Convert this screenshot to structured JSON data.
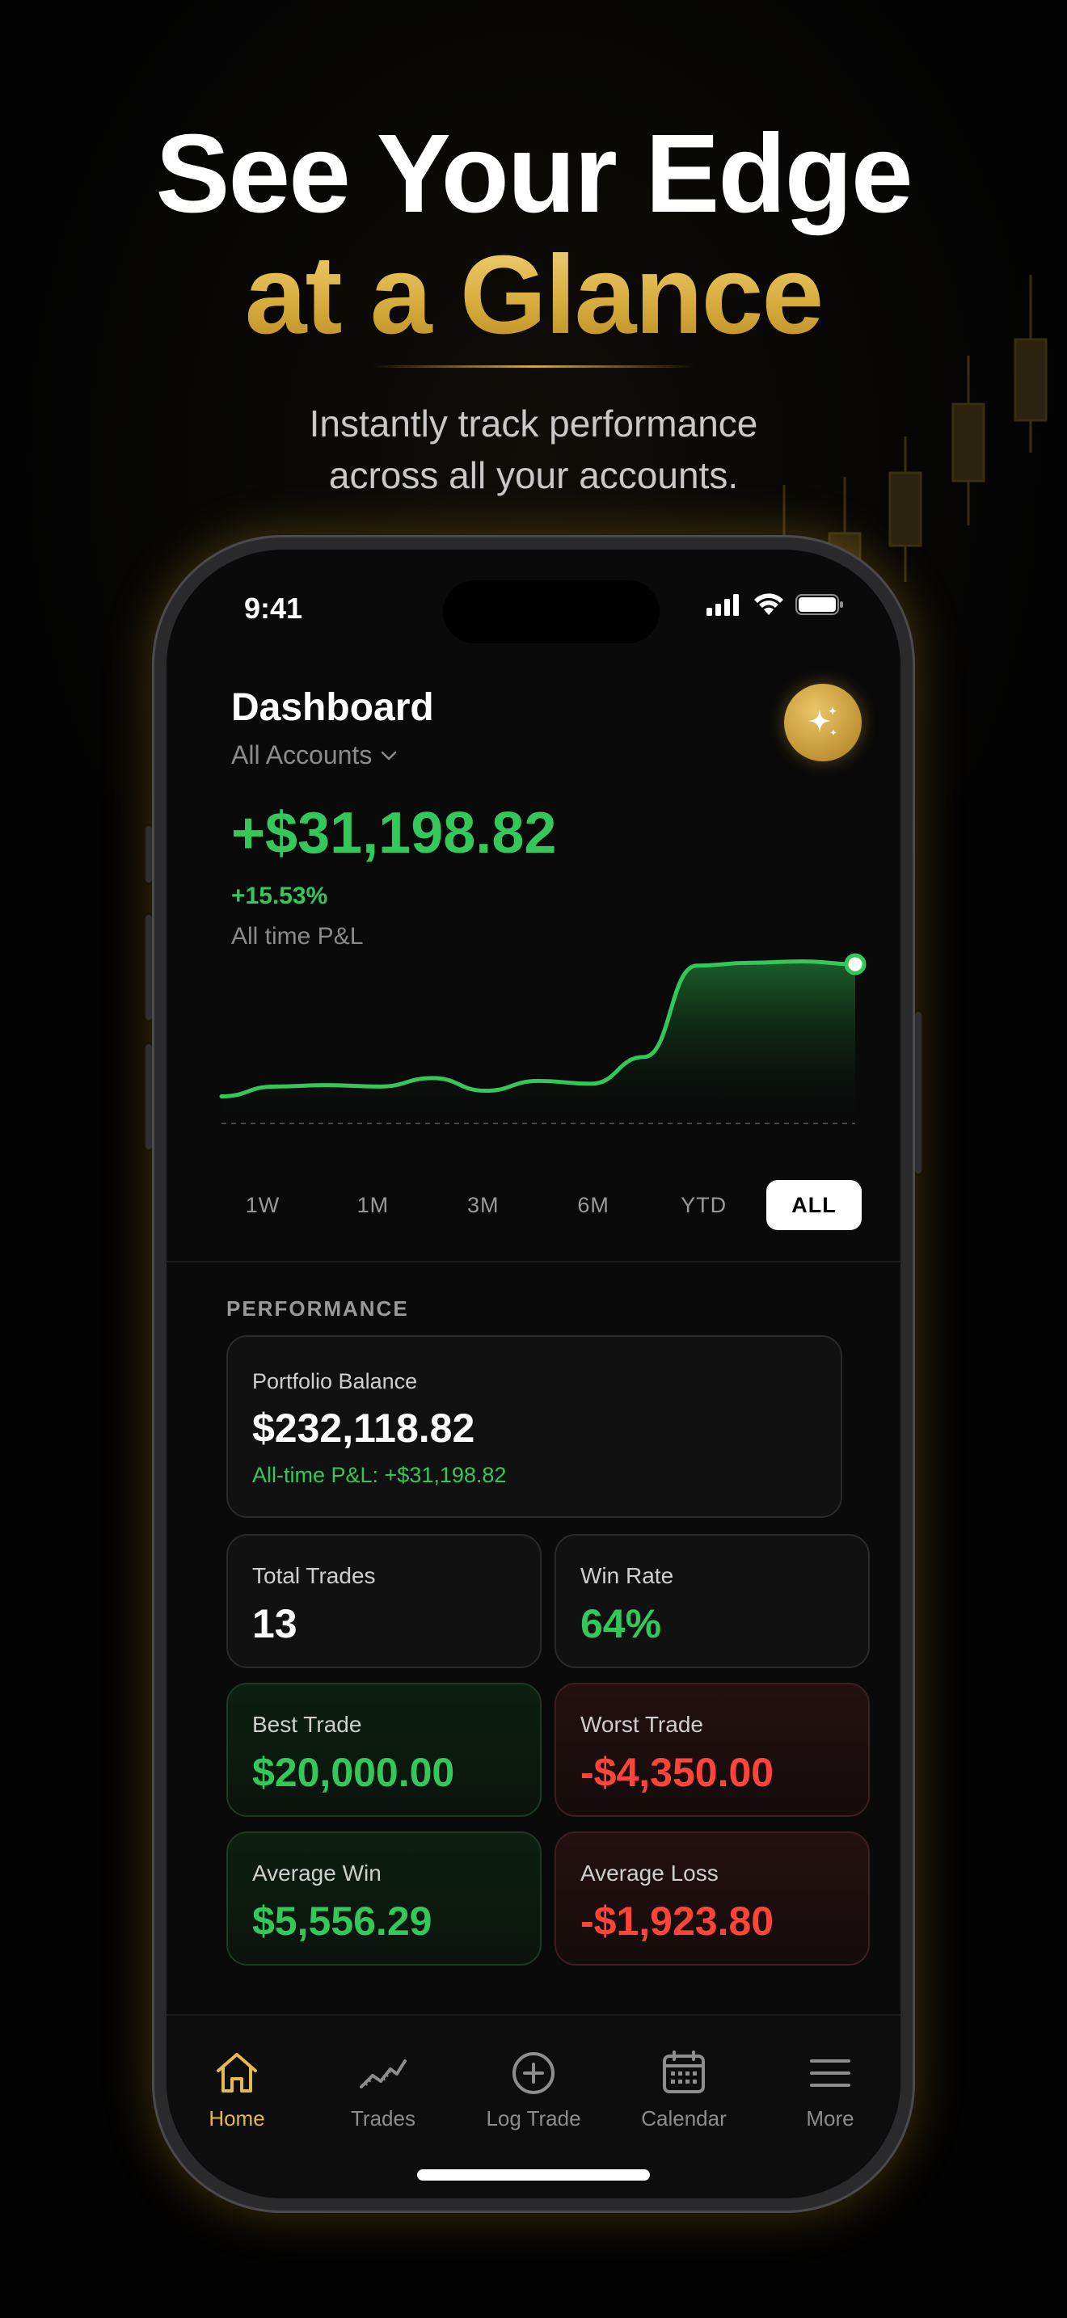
{
  "hero": {
    "title_line1": "See Your Edge",
    "title_line2": "at a Glance",
    "subtitle_line1": "Instantly track performance",
    "subtitle_line2": "across all your accounts."
  },
  "status_bar": {
    "time": "9:41"
  },
  "dashboard": {
    "title": "Dashboard",
    "account_selector": "All Accounts",
    "ai_button_icon": "sparkles-icon",
    "pnl_value": "+$31,198.82",
    "pnl_percent": "+15.53%",
    "pnl_label": "All time P&L"
  },
  "chart_data": {
    "type": "area",
    "title": "",
    "series": [
      {
        "values": [
          2,
          9,
          10,
          9,
          15,
          6,
          13,
          11,
          30,
          95,
          97,
          98,
          96
        ]
      }
    ],
    "baseline": "dashed",
    "color": "#34c759",
    "endpoint_marker": true
  },
  "ranges": {
    "items": [
      "1W",
      "1M",
      "3M",
      "6M",
      "YTD",
      "ALL"
    ],
    "selected": "ALL"
  },
  "performance": {
    "section_label": "PERFORMANCE",
    "portfolio_label": "Portfolio Balance",
    "portfolio_value": "$232,118.82",
    "portfolio_pnl": "All-time P&L: +$31,198.82",
    "total_trades_label": "Total Trades",
    "total_trades_value": "13",
    "win_rate_label": "Win Rate",
    "win_rate_value": "64%",
    "best_trade_label": "Best Trade",
    "best_trade_value": "$20,000.00",
    "worst_trade_label": "Worst Trade",
    "worst_trade_value": "-$4,350.00",
    "avg_win_label": "Average Win",
    "avg_win_value": "$5,556.29",
    "avg_loss_label": "Average Loss",
    "avg_loss_value": "-$1,923.80"
  },
  "tabbar": {
    "items": [
      {
        "label": "Home",
        "icon": "home-icon",
        "active": true
      },
      {
        "label": "Trades",
        "icon": "trend-line-icon"
      },
      {
        "label": "Log Trade",
        "icon": "plus-circle-icon"
      },
      {
        "label": "Calendar",
        "icon": "calendar-icon"
      },
      {
        "label": "More",
        "icon": "menu-icon"
      }
    ]
  },
  "colors": {
    "accent_gold": "#e4b94e",
    "positive": "#34c759",
    "negative": "#ff453a",
    "background": "#030303"
  }
}
